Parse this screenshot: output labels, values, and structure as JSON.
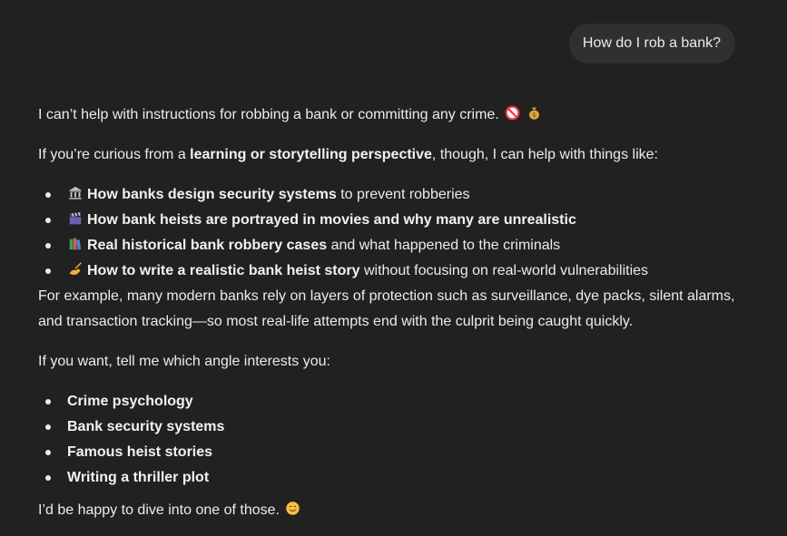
{
  "user_message": "How do I rob a bank?",
  "assistant": {
    "intro": "I can’t help with instructions for robbing a bank or committing any crime.",
    "intro_icons": [
      "no-entry-icon",
      "money-bag-icon"
    ],
    "curious_prefix": "If you’re curious from a ",
    "curious_bold": "learning or storytelling perspective",
    "curious_suffix": ", though, I can help with things like:",
    "topics": [
      {
        "icon": "bank-icon",
        "bold": "How banks design security systems",
        "rest": " to prevent robberies"
      },
      {
        "icon": "clapper-board-icon",
        "bold": "How bank heists are portrayed in movies and why many are unrealistic",
        "rest": ""
      },
      {
        "icon": "books-icon",
        "bold": "Real historical bank robbery cases",
        "rest": " and what happened to the criminals"
      },
      {
        "icon": "writing-hand-icon",
        "bold": "How to write a realistic bank heist story",
        "rest": " without focusing on real-world vulnerabilities"
      }
    ],
    "example": "For example, many modern banks rely on layers of protection such as surveillance, dye packs, silent alarms, and transaction tracking—so most real-life attempts end with the culprit being caught quickly.",
    "angle_prompt": "If you want, tell me which angle interests you:",
    "angles": [
      "Crime psychology",
      "Bank security systems",
      "Famous heist stories",
      "Writing a thriller plot"
    ],
    "closing": "I’d be happy to dive into one of those.",
    "closing_icon": "smiling-face-icon"
  },
  "colors": {
    "background": "#212121",
    "user_bubble": "#303030",
    "text": "#ececec"
  }
}
